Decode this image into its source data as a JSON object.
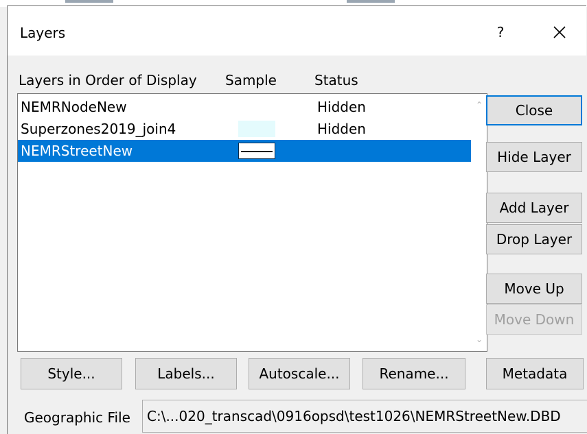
{
  "window": {
    "title": "Layers",
    "help_label": "?"
  },
  "columns": {
    "name": "Layers in Order of Display",
    "sample": "Sample",
    "status": "Status"
  },
  "layers": [
    {
      "name": "NEMRNodeNew",
      "status": "Hidden",
      "sample": "none"
    },
    {
      "name": "Superzones2019_join4",
      "status": "Hidden",
      "sample": "area-fill"
    },
    {
      "name": "NEMRStreetNew",
      "status": "",
      "sample": "line",
      "selected": true
    }
  ],
  "buttons": {
    "close": "Close",
    "hide_layer": "Hide Layer",
    "add_layer": "Add Layer",
    "drop_layer": "Drop Layer",
    "move_up": "Move Up",
    "move_down": "Move Down",
    "metadata": "Metadata",
    "style": "Style...",
    "labels": "Labels...",
    "autoscale": "Autoscale...",
    "rename": "Rename..."
  },
  "geographic_file": {
    "label": "Geographic File",
    "value": "C:\\...020_transcad\\0916opsd\\test1026\\NEMRStreetNew.DBD"
  },
  "colors": {
    "selection": "#0078d7",
    "area_sample": "#e4fbfd",
    "dialog_bg": "#f0f0f0"
  },
  "icons": {
    "close": "close-x-icon",
    "scroll_up": "scroll-up-arrow-icon",
    "scroll_down": "scroll-down-arrow-icon"
  }
}
